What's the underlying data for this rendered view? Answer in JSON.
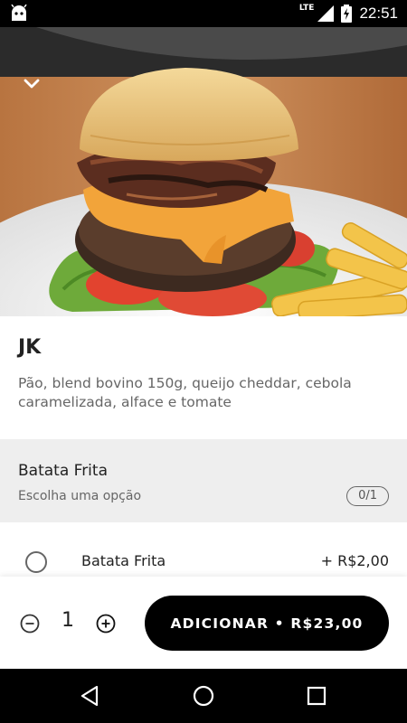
{
  "status_bar": {
    "network": "LTE",
    "time": "22:51",
    "icons": [
      "android-icon",
      "signal-icon",
      "battery-charging-icon"
    ]
  },
  "hero": {
    "image": "burger-photo",
    "collapse_icon": "chevron-down-icon"
  },
  "product": {
    "name": "JK",
    "description": "Pão, blend bovino 150g, queijo cheddar, cebola caramelizada, alface e tomate"
  },
  "section": {
    "title": "Batata Frita",
    "subtitle": "Escolha uma opção",
    "badge": "0/1"
  },
  "option": {
    "label": "Batata Frita",
    "price": "+ R$2,00",
    "selected": false
  },
  "action_bar": {
    "quantity": "1",
    "add_label": "ADICIONAR • R$23,00"
  },
  "nav_bar": {
    "icons": [
      "back-icon",
      "home-icon",
      "recents-icon"
    ]
  }
}
